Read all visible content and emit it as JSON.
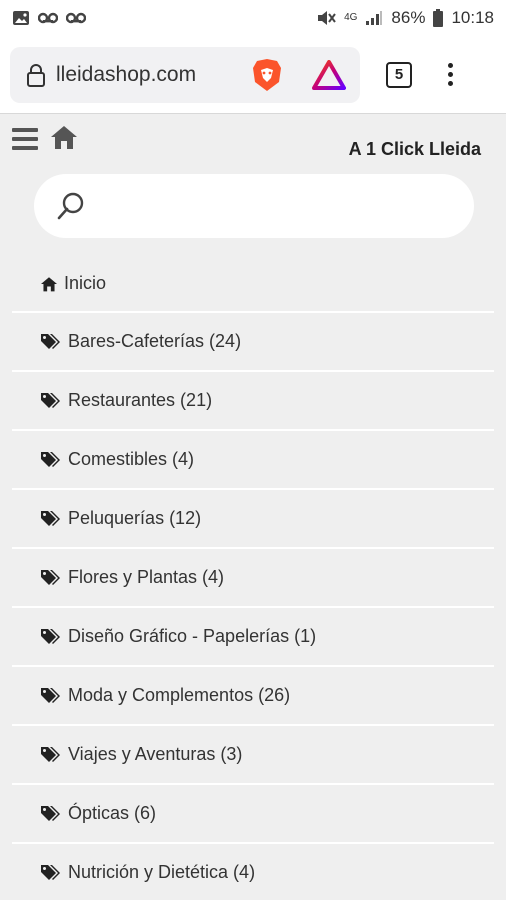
{
  "status": {
    "battery": "86%",
    "time": "10:18",
    "network": "4G"
  },
  "browser": {
    "url": "lleidashop.com",
    "tab_count": "5"
  },
  "site": {
    "title": "A 1 Click Lleida"
  },
  "search": {
    "placeholder": ""
  },
  "menu": {
    "items": [
      {
        "label": "Inicio",
        "icon": "home-icon"
      },
      {
        "label": "Bares-Cafeterías (24)",
        "icon": "tags-icon"
      },
      {
        "label": "Restaurantes (21)",
        "icon": "tags-icon"
      },
      {
        "label": "Comestibles (4)",
        "icon": "tags-icon"
      },
      {
        "label": "Peluquerías (12)",
        "icon": "tags-icon"
      },
      {
        "label": "Flores y Plantas (4)",
        "icon": "tags-icon"
      },
      {
        "label": "Diseño Gráfico - Papelerías (1)",
        "icon": "tags-icon"
      },
      {
        "label": "Moda y Complementos (26)",
        "icon": "tags-icon"
      },
      {
        "label": "Viajes y Aventuras (3)",
        "icon": "tags-icon"
      },
      {
        "label": "Ópticas (6)",
        "icon": "tags-icon"
      },
      {
        "label": "Nutrición y Dietética (4)",
        "icon": "tags-icon"
      }
    ]
  },
  "colors": {
    "page_bg": "#efefef",
    "brave_orange": "#fb542b"
  }
}
